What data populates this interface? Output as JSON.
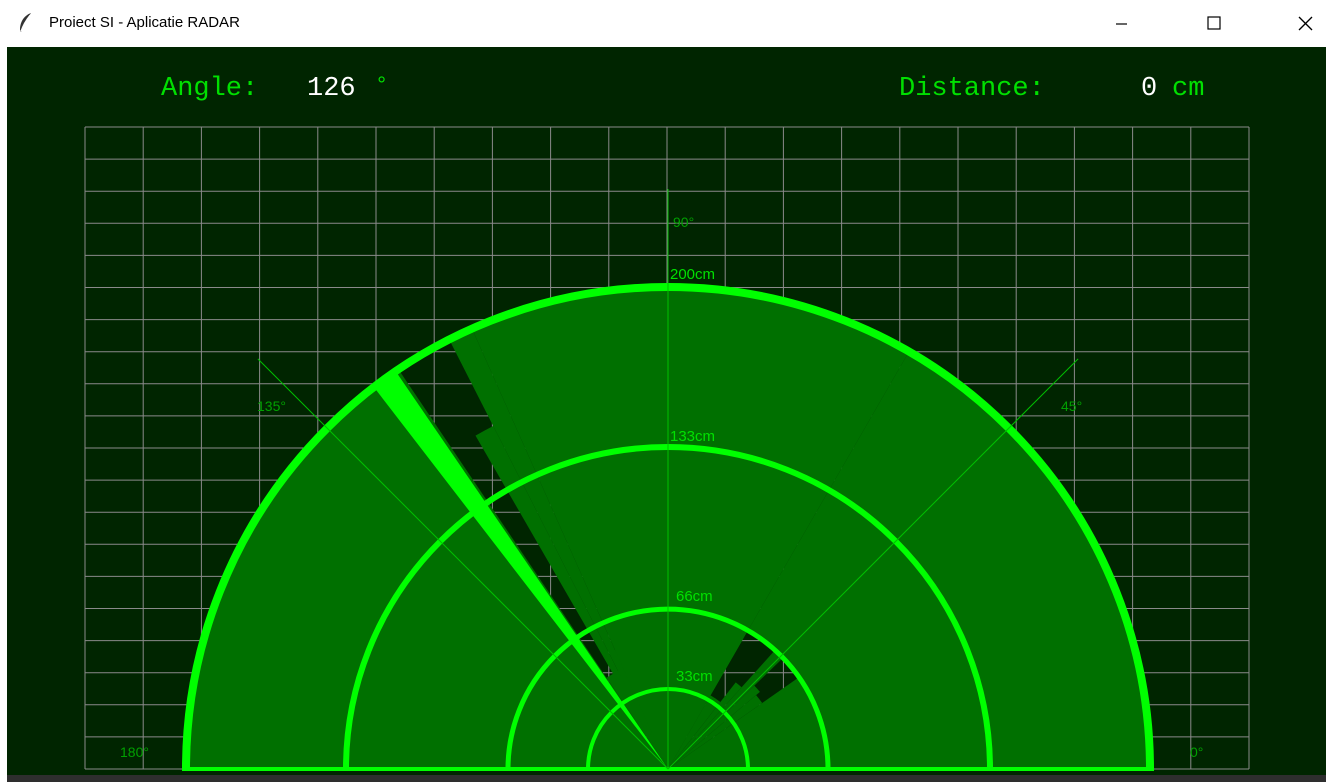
{
  "window": {
    "title": "Proiect SI - Aplicatie RADAR",
    "app_icon": "feather-icon",
    "controls": [
      "minimize-icon",
      "maximize-icon",
      "close-icon"
    ]
  },
  "readout": {
    "angle_label": "Angle:",
    "angle_value": "126",
    "angle_unit": "°",
    "distance_label": "Distance:",
    "distance_value": "0",
    "distance_unit": "cm"
  },
  "radar": {
    "range_labels": [
      "200cm",
      "133cm",
      "66cm",
      "33cm"
    ],
    "angle_labels": [
      "90°",
      "135°",
      "45°",
      "180°",
      "0°"
    ],
    "current_angle_deg": 126,
    "max_range_cm": 200
  },
  "colors": {
    "background": "#002500",
    "fill": "#007000",
    "ring": "#00ff00",
    "grid": "#8a8a8a",
    "text_label": "#00e000",
    "text_value": "#ffffff"
  }
}
